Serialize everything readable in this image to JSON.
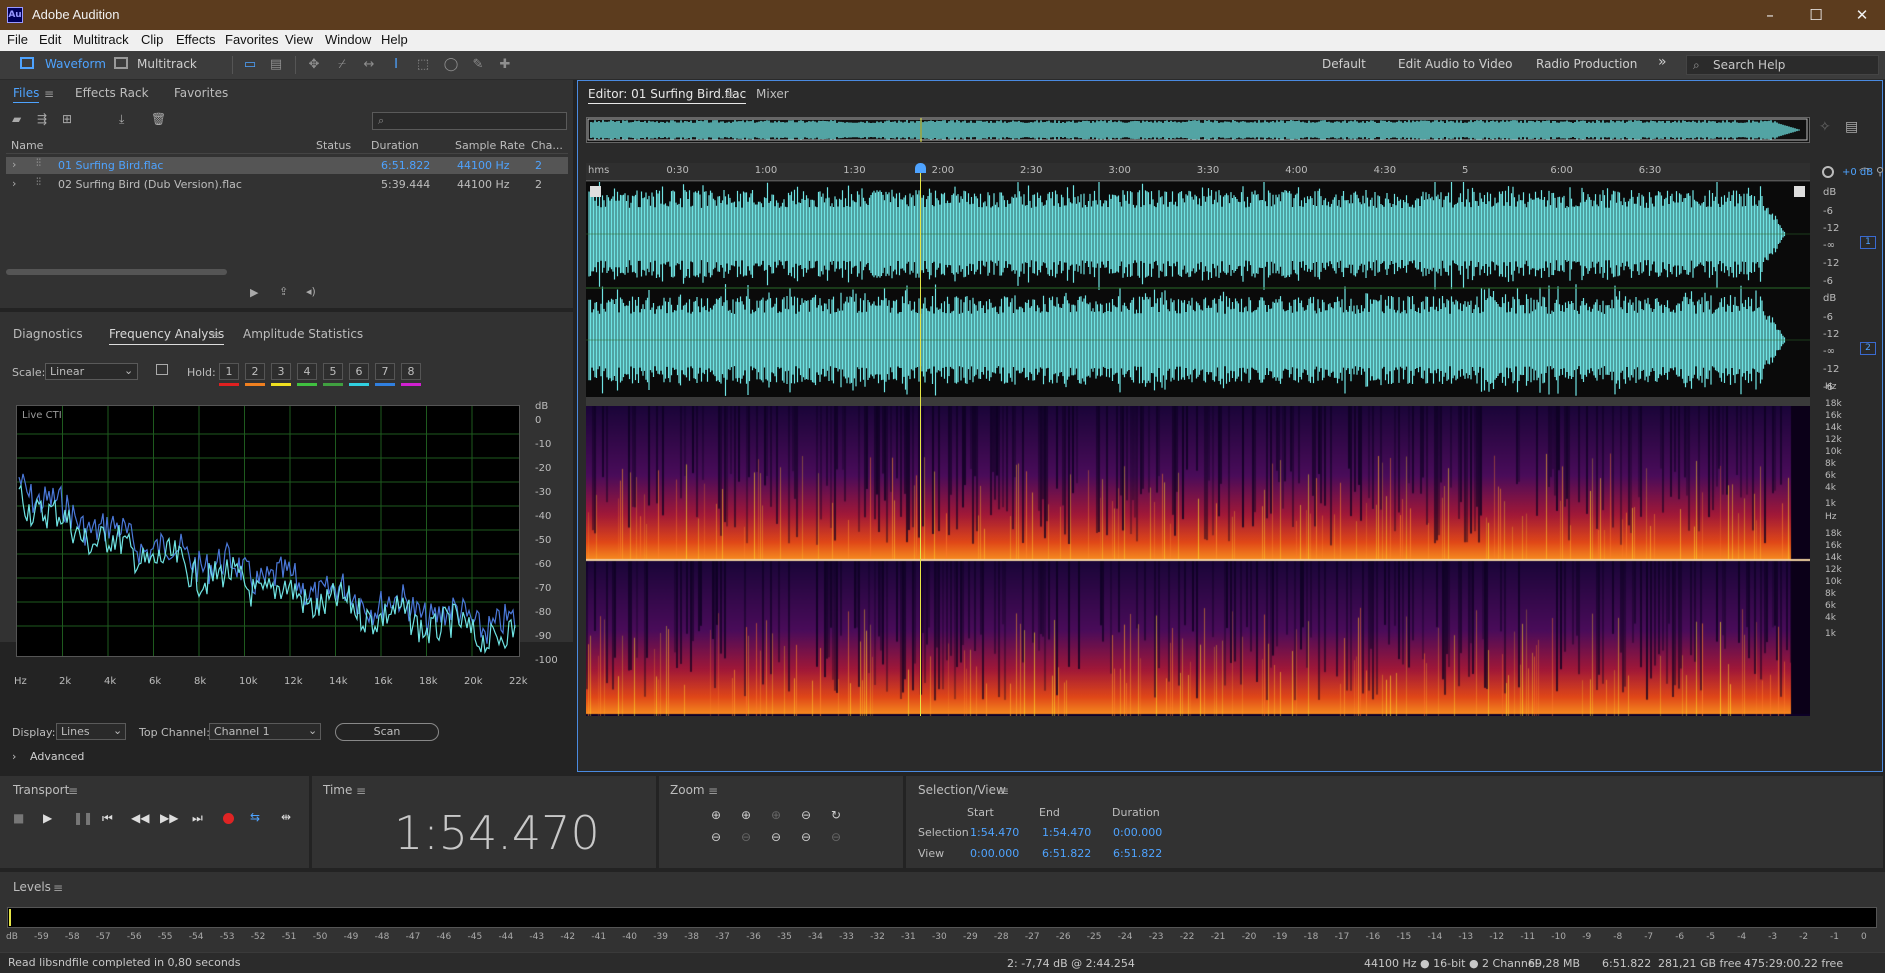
{
  "app": {
    "title": "Adobe Audition",
    "logo": "Au",
    "window_controls": {
      "minimize": "–",
      "maximize": "☐",
      "close": "✕"
    }
  },
  "menu": [
    "File",
    "Edit",
    "Multitrack",
    "Clip",
    "Effects",
    "Favorites",
    "View",
    "Window",
    "Help"
  ],
  "toolbar": {
    "waveform": "Waveform",
    "multitrack": "Multitrack",
    "workspaces": [
      "Default",
      "Edit Audio to Video",
      "Radio Production"
    ],
    "more": "»",
    "search_placeholder": "Search Help"
  },
  "files_panel": {
    "tabs": [
      "Files",
      "Effects Rack",
      "Favorites"
    ],
    "columns": [
      "Name",
      "Status",
      "Duration",
      "Sample Rate",
      "Cha..."
    ],
    "rows": [
      {
        "name": "01 Surfing Bird.flac",
        "status": "",
        "duration": "6:51.822",
        "rate": "44100 Hz",
        "channels": "2",
        "selected": true
      },
      {
        "name": "02 Surfing Bird (Dub Version).flac",
        "status": "",
        "duration": "5:39.444",
        "rate": "44100 Hz",
        "channels": "2",
        "selected": false
      }
    ]
  },
  "analysis_panel": {
    "tabs": [
      "Diagnostics",
      "Frequency Analysis",
      "Amplitude Statistics"
    ],
    "scale_label": "Scale:",
    "scale_value": "Linear",
    "hold_label": "Hold:",
    "holds": [
      "1",
      "2",
      "3",
      "4",
      "5",
      "6",
      "7",
      "8"
    ],
    "hold_colors": [
      "#e02020",
      "#f08020",
      "#f0e020",
      "#40c040",
      "#40a040",
      "#30d0e0",
      "#3080e0",
      "#d020d0"
    ],
    "live_label": "Live CTI",
    "db_unit": "dB",
    "db_ticks": [
      "0",
      "-10",
      "-20",
      "-30",
      "-40",
      "-50",
      "-60",
      "-70",
      "-80",
      "-90",
      "-100"
    ],
    "hz_ticks": [
      "Hz",
      "2k",
      "4k",
      "6k",
      "8k",
      "10k",
      "12k",
      "14k",
      "16k",
      "18k",
      "20k",
      "22k"
    ],
    "display_label": "Display:",
    "display_value": "Lines",
    "top_channel_label": "Top Channel:",
    "top_channel_value": "Channel 1",
    "scan": "Scan",
    "advanced": "Advanced"
  },
  "editor": {
    "tab": "Editor: 01 Surfing Bird.flac",
    "mixer": "Mixer",
    "ruler": [
      "hms",
      "0:30",
      "1:00",
      "1:30",
      "2:00",
      "2:30",
      "3:00",
      "3:30",
      "4:00",
      "4:30",
      "5",
      "6:00",
      "6:30"
    ],
    "gain": "+0 dB",
    "db_ticks_top": [
      "dB",
      "-6",
      "-12",
      "-∞",
      "-12",
      "-6"
    ],
    "db_ticks_bottom": [
      "dB",
      "-6",
      "-12",
      "-∞",
      "-12",
      "-6"
    ],
    "channel_badges": [
      "1",
      "2"
    ],
    "hz_ticks": [
      "Hz",
      "18k",
      "16k",
      "14k",
      "12k",
      "10k",
      "8k",
      "6k",
      "4k",
      "1k"
    ]
  },
  "transport": {
    "title": "Transport"
  },
  "time": {
    "title": "Time",
    "value": "1:54.470"
  },
  "zoom": {
    "title": "Zoom"
  },
  "selection": {
    "title": "Selection/View",
    "cols": [
      "Start",
      "End",
      "Duration"
    ],
    "rows": [
      {
        "label": "Selection",
        "start": "1:54.470",
        "end": "1:54.470",
        "duration": "0:00.000"
      },
      {
        "label": "View",
        "start": "0:00.000",
        "end": "6:51.822",
        "duration": "6:51.822"
      }
    ]
  },
  "levels": {
    "title": "Levels",
    "scale": [
      "dB",
      "-59",
      "-58",
      "-57",
      "-56",
      "-55",
      "-54",
      "-53",
      "-52",
      "-51",
      "-50",
      "-49",
      "-48",
      "-47",
      "-46",
      "-45",
      "-44",
      "-43",
      "-42",
      "-41",
      "-40",
      "-39",
      "-38",
      "-37",
      "-36",
      "-35",
      "-34",
      "-33",
      "-32",
      "-31",
      "-30",
      "-29",
      "-28",
      "-27",
      "-26",
      "-25",
      "-24",
      "-23",
      "-22",
      "-21",
      "-20",
      "-19",
      "-18",
      "-17",
      "-16",
      "-15",
      "-14",
      "-13",
      "-12",
      "-11",
      "-10",
      "-9",
      "-8",
      "-7",
      "-6",
      "-5",
      "-4",
      "-3",
      "-2",
      "-1",
      "0"
    ]
  },
  "status": {
    "left": "Read libsndfile completed in 0,80 seconds",
    "cursor": "2: -7,74 dB @ 2:44.254",
    "format": "44100 Hz ● 16-bit ● 2 Channel",
    "size": "69,28 MB",
    "duration": "6:51.822",
    "free": "281,21 GB free",
    "time_free": "475:29:00.22 free"
  },
  "colors": {
    "accent": "#4ea3ff",
    "waveform": "#6fe3e3",
    "titlebar": "#5c3c1e",
    "playhead": "#e6e645"
  }
}
